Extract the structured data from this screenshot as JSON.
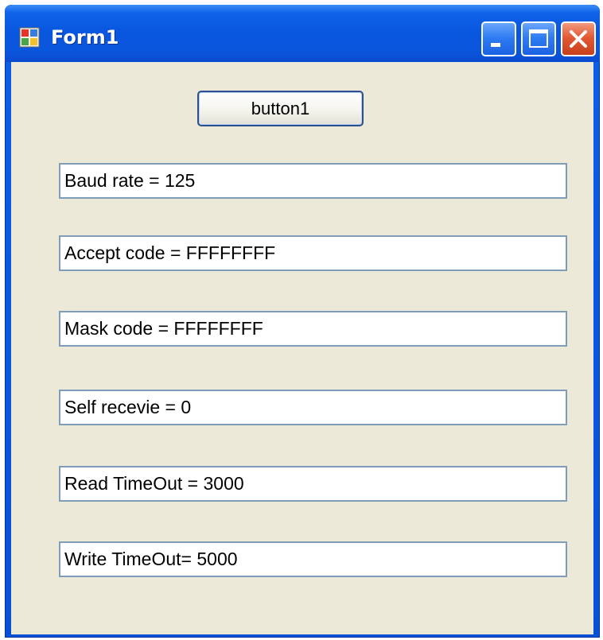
{
  "window": {
    "title": "Form1",
    "app_icon": "form-app-icon",
    "controls": {
      "minimize_icon": "minimize-icon",
      "maximize_icon": "maximize-icon",
      "close_icon": "close-icon"
    },
    "colors": {
      "titlebar": "#0a56dc",
      "client_background": "#ece9d8",
      "close_button": "#e25a34",
      "textbox_border": "#7f9db9"
    }
  },
  "form": {
    "button1_label": "button1",
    "textboxes": [
      "Baud rate = 125",
      "Accept code = FFFFFFFF",
      "Mask code = FFFFFFFF",
      "Self recevie = 0",
      "Read TimeOut = 3000",
      "Write TimeOut= 5000"
    ]
  }
}
